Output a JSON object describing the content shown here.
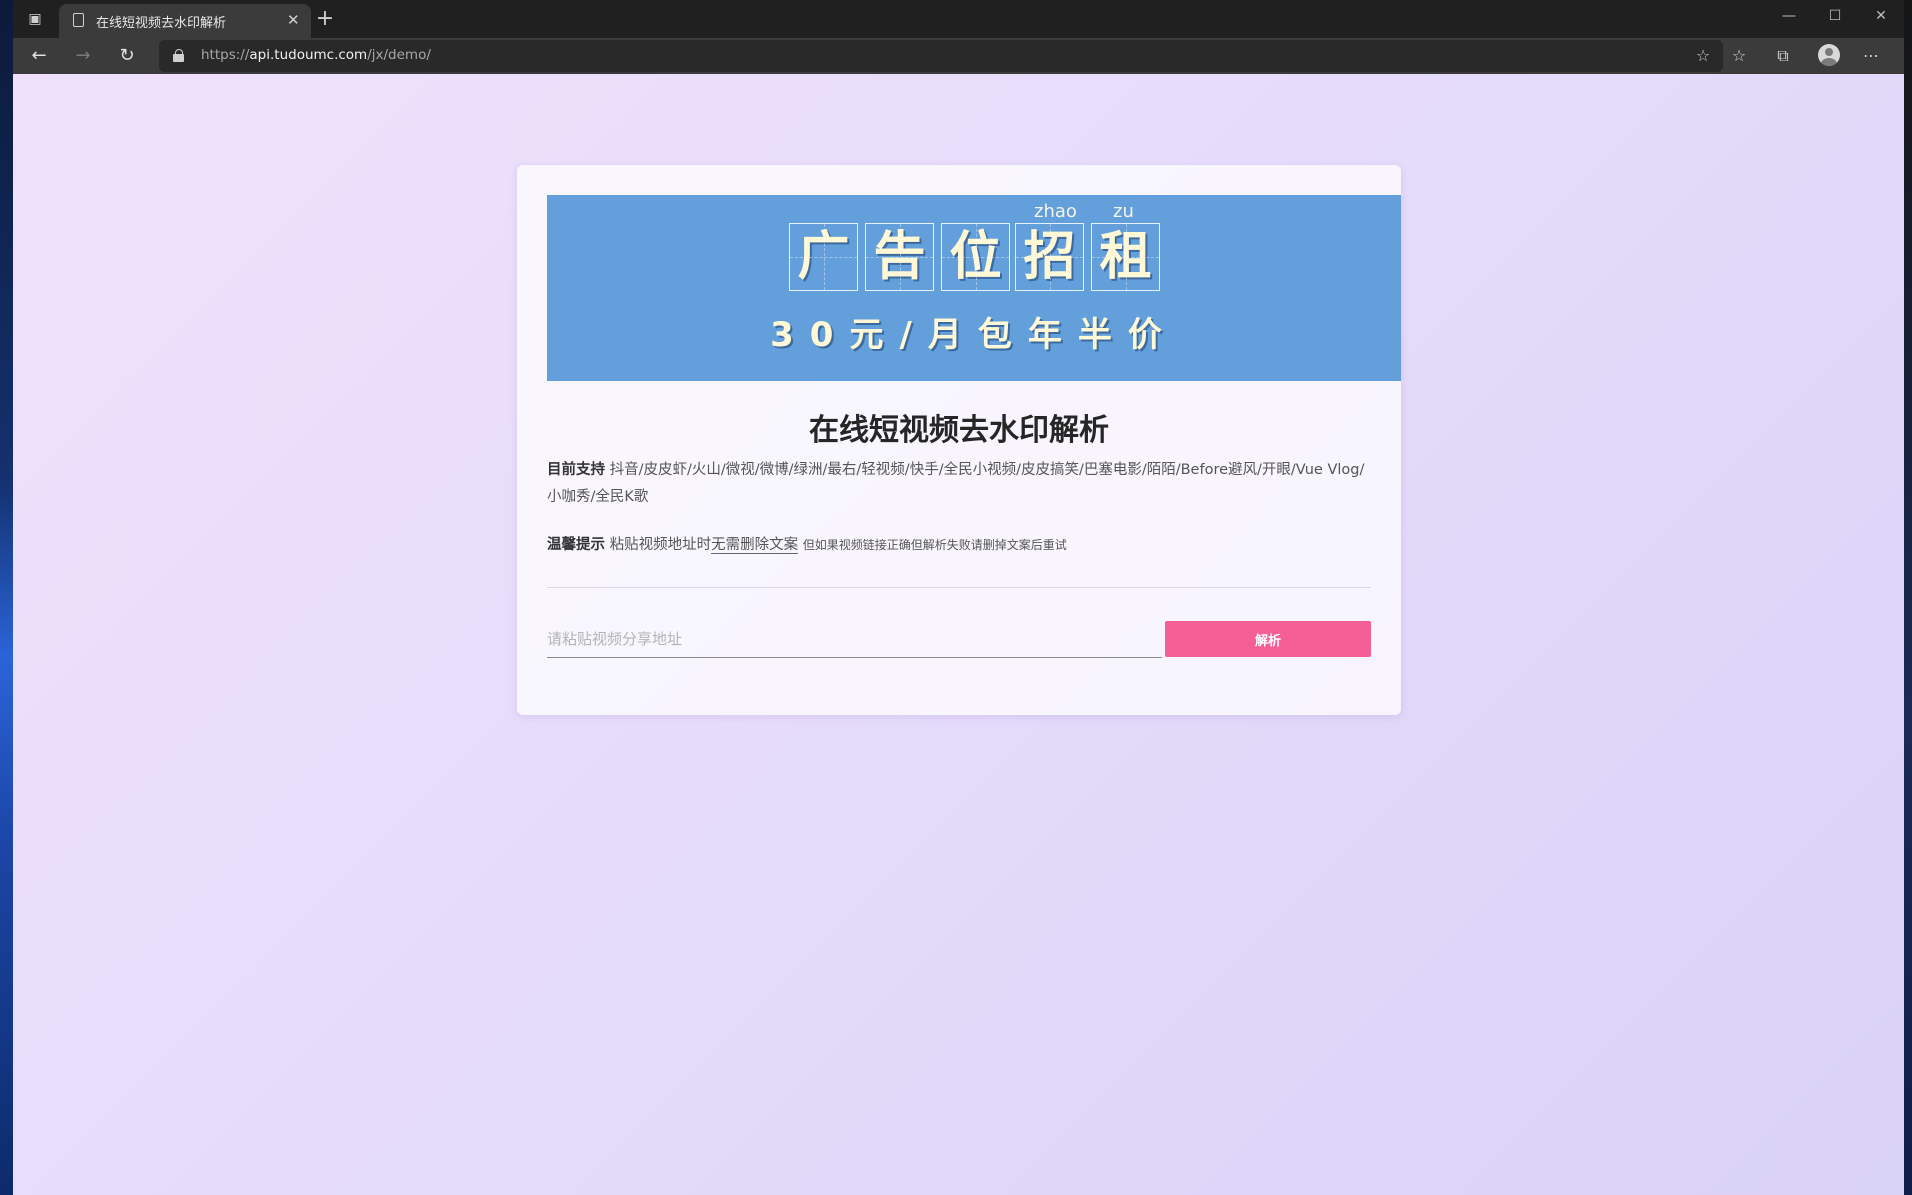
{
  "tab": {
    "title": "在线短视频去水印解析"
  },
  "address": {
    "scheme": "https://",
    "host": "api.tudoumc.com",
    "path": "/jx/demo/"
  },
  "banner": {
    "pinyin": [
      "zhao",
      "zu"
    ],
    "chars": [
      "广",
      "告",
      "位",
      "招",
      "租"
    ],
    "subtitle": "30元/月包年半价"
  },
  "main": {
    "title": "在线短视频去水印解析",
    "support_label": "目前支持",
    "support_text": "抖音/皮皮虾/火山/微视/微博/绿洲/最右/轻视频/快手/全民小视频/皮皮搞笑/巴塞电影/陌陌/Before避风/开眼/Vue Vlog/小咖秀/全民K歌",
    "tip_label": "温馨提示",
    "tip_text": "粘贴视频地址时",
    "tip_emphasis": "无需删除文案",
    "tip_small": "但如果视频链接正确但解析失败请删掉文案后重试",
    "input_placeholder": "请粘贴视频分享地址",
    "input_value": "",
    "button_label": "解析"
  },
  "colors": {
    "banner_bg": "#629fdb",
    "button_bg": "#f45f95"
  }
}
